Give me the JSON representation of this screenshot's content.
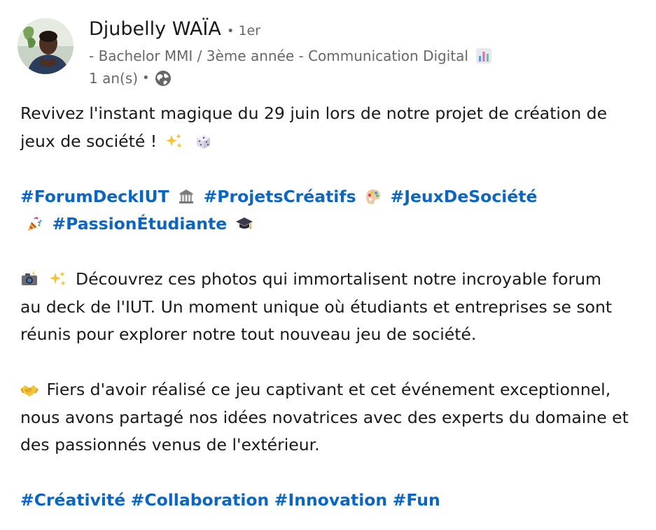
{
  "author": {
    "name": "Djubelly WAÏA",
    "separator": "•",
    "degree": "1er",
    "headline": "- Bachelor MMI / 3ème année - Communication Digital",
    "time": "1 an(s)",
    "time_separator": "•"
  },
  "icons": {
    "headline_icon": "bar-chart-icon",
    "visibility": "globe-icon"
  },
  "post": {
    "p1_l1": "Revivez l'instant magique du 29 juin lors de notre projet de création de",
    "p1_l2": "jeux de société !",
    "hashtags": [
      "#ForumDeckIUT",
      "#ProjetsCréatifs",
      "#JeuxDeSociété",
      "#PassionÉtudiante"
    ],
    "p2_l1": "Découvrez ces photos qui immortalisent notre incroyable forum",
    "p2_l2": "au deck de l'IUT. Un moment unique où étudiants et entreprises se sont",
    "p2_l3": "réunis pour explorer notre tout nouveau jeu de société.",
    "p3_l1": "Fiers d'avoir réalisé ce jeu captivant et cet événement exceptionnel,",
    "p3_l2": "nous avons partagé nos idées novatrices avec des experts du domaine et",
    "p3_l3": "des passionnés venus de l'extérieur.",
    "final_hashtags": [
      "#Créativité",
      "#Collaboration",
      "#Innovation",
      "#Fun"
    ]
  },
  "colors": {
    "link": "#0a66c2",
    "text": "#191919",
    "muted": "#666666"
  }
}
